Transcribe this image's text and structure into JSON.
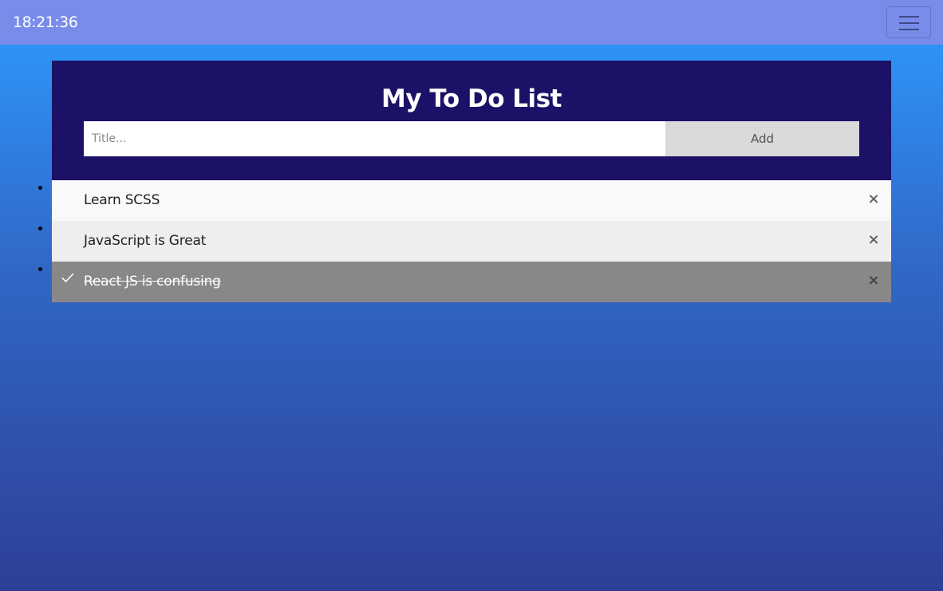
{
  "navbar": {
    "clock": "18:21:36",
    "menu_icon": "hamburger-menu-icon"
  },
  "header": {
    "title": "My To Do List",
    "input": {
      "placeholder": "Title...",
      "value": ""
    },
    "add_label": "Add"
  },
  "todos": [
    {
      "label": "Learn SCSS",
      "checked": false,
      "close_glyph": "×"
    },
    {
      "label": "JavaScript is Great",
      "checked": false,
      "close_glyph": "×"
    },
    {
      "label": "React JS is confusing",
      "checked": true,
      "close_glyph": "×"
    }
  ],
  "colors": {
    "navbar": "#7a8cea",
    "header": "#1b1267",
    "checked_item": "#888888",
    "add_button": "#d9d9d9"
  }
}
